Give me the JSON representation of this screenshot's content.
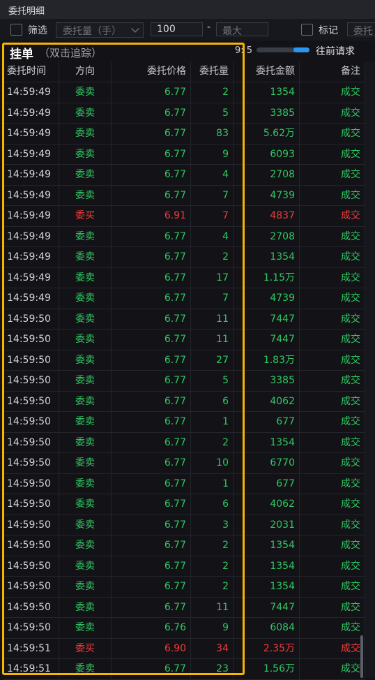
{
  "window": {
    "title": "委托明细"
  },
  "filter": {
    "filter_label": "筛选",
    "volume_select": "委托量（手）",
    "min_value": "100",
    "separator": "-",
    "max_placeholder": "最大",
    "mark_label": "标记",
    "truncated_select": "委托"
  },
  "panel": {
    "title": "挂单",
    "subtitle": "（双击追踪）",
    "time_label": "9: 5",
    "prev_request": "往前请求",
    "slider_fill_fraction": 0.3
  },
  "table": {
    "columns": [
      "委托时间",
      "方向",
      "委托价格",
      "委托量",
      "委托金额",
      "备注"
    ],
    "rows": [
      {
        "time": "14:59:49",
        "dir": "委卖",
        "price": "6.77",
        "qty": "2",
        "amount": "1354",
        "note": "成交"
      },
      {
        "time": "14:59:49",
        "dir": "委卖",
        "price": "6.77",
        "qty": "5",
        "amount": "3385",
        "note": "成交"
      },
      {
        "time": "14:59:49",
        "dir": "委卖",
        "price": "6.77",
        "qty": "83",
        "amount": "5.62万",
        "note": "成交"
      },
      {
        "time": "14:59:49",
        "dir": "委卖",
        "price": "6.77",
        "qty": "9",
        "amount": "6093",
        "note": "成交"
      },
      {
        "time": "14:59:49",
        "dir": "委卖",
        "price": "6.77",
        "qty": "4",
        "amount": "2708",
        "note": "成交"
      },
      {
        "time": "14:59:49",
        "dir": "委卖",
        "price": "6.77",
        "qty": "7",
        "amount": "4739",
        "note": "成交"
      },
      {
        "time": "14:59:49",
        "dir": "委买",
        "price": "6.91",
        "qty": "7",
        "amount": "4837",
        "note": "成交"
      },
      {
        "time": "14:59:49",
        "dir": "委卖",
        "price": "6.77",
        "qty": "4",
        "amount": "2708",
        "note": "成交"
      },
      {
        "time": "14:59:49",
        "dir": "委卖",
        "price": "6.77",
        "qty": "2",
        "amount": "1354",
        "note": "成交"
      },
      {
        "time": "14:59:49",
        "dir": "委卖",
        "price": "6.77",
        "qty": "17",
        "amount": "1.15万",
        "note": "成交"
      },
      {
        "time": "14:59:49",
        "dir": "委卖",
        "price": "6.77",
        "qty": "7",
        "amount": "4739",
        "note": "成交"
      },
      {
        "time": "14:59:50",
        "dir": "委卖",
        "price": "6.77",
        "qty": "11",
        "amount": "7447",
        "note": "成交"
      },
      {
        "time": "14:59:50",
        "dir": "委卖",
        "price": "6.77",
        "qty": "11",
        "amount": "7447",
        "note": "成交"
      },
      {
        "time": "14:59:50",
        "dir": "委卖",
        "price": "6.77",
        "qty": "27",
        "amount": "1.83万",
        "note": "成交"
      },
      {
        "time": "14:59:50",
        "dir": "委卖",
        "price": "6.77",
        "qty": "5",
        "amount": "3385",
        "note": "成交"
      },
      {
        "time": "14:59:50",
        "dir": "委卖",
        "price": "6.77",
        "qty": "6",
        "amount": "4062",
        "note": "成交"
      },
      {
        "time": "14:59:50",
        "dir": "委卖",
        "price": "6.77",
        "qty": "1",
        "amount": "677",
        "note": "成交"
      },
      {
        "time": "14:59:50",
        "dir": "委卖",
        "price": "6.77",
        "qty": "2",
        "amount": "1354",
        "note": "成交"
      },
      {
        "time": "14:59:50",
        "dir": "委卖",
        "price": "6.77",
        "qty": "10",
        "amount": "6770",
        "note": "成交"
      },
      {
        "time": "14:59:50",
        "dir": "委卖",
        "price": "6.77",
        "qty": "1",
        "amount": "677",
        "note": "成交"
      },
      {
        "time": "14:59:50",
        "dir": "委卖",
        "price": "6.77",
        "qty": "6",
        "amount": "4062",
        "note": "成交"
      },
      {
        "time": "14:59:50",
        "dir": "委卖",
        "price": "6.77",
        "qty": "3",
        "amount": "2031",
        "note": "成交"
      },
      {
        "time": "14:59:50",
        "dir": "委卖",
        "price": "6.77",
        "qty": "2",
        "amount": "1354",
        "note": "成交"
      },
      {
        "time": "14:59:50",
        "dir": "委卖",
        "price": "6.77",
        "qty": "2",
        "amount": "1354",
        "note": "成交"
      },
      {
        "time": "14:59:50",
        "dir": "委卖",
        "price": "6.77",
        "qty": "2",
        "amount": "1354",
        "note": "成交"
      },
      {
        "time": "14:59:50",
        "dir": "委卖",
        "price": "6.77",
        "qty": "11",
        "amount": "7447",
        "note": "成交"
      },
      {
        "time": "14:59:50",
        "dir": "委卖",
        "price": "6.76",
        "qty": "9",
        "amount": "6084",
        "note": "成交"
      },
      {
        "time": "14:59:51",
        "dir": "委买",
        "price": "6.90",
        "qty": "34",
        "amount": "2.35万",
        "note": "成交"
      },
      {
        "time": "14:59:51",
        "dir": "委卖",
        "price": "6.77",
        "qty": "23",
        "amount": "1.56万",
        "note": "成交"
      }
    ]
  },
  "colors": {
    "sell": "#2fc862",
    "buy": "#ee3b3b",
    "highlight": "#f7b500",
    "accent": "#2b96f0"
  }
}
